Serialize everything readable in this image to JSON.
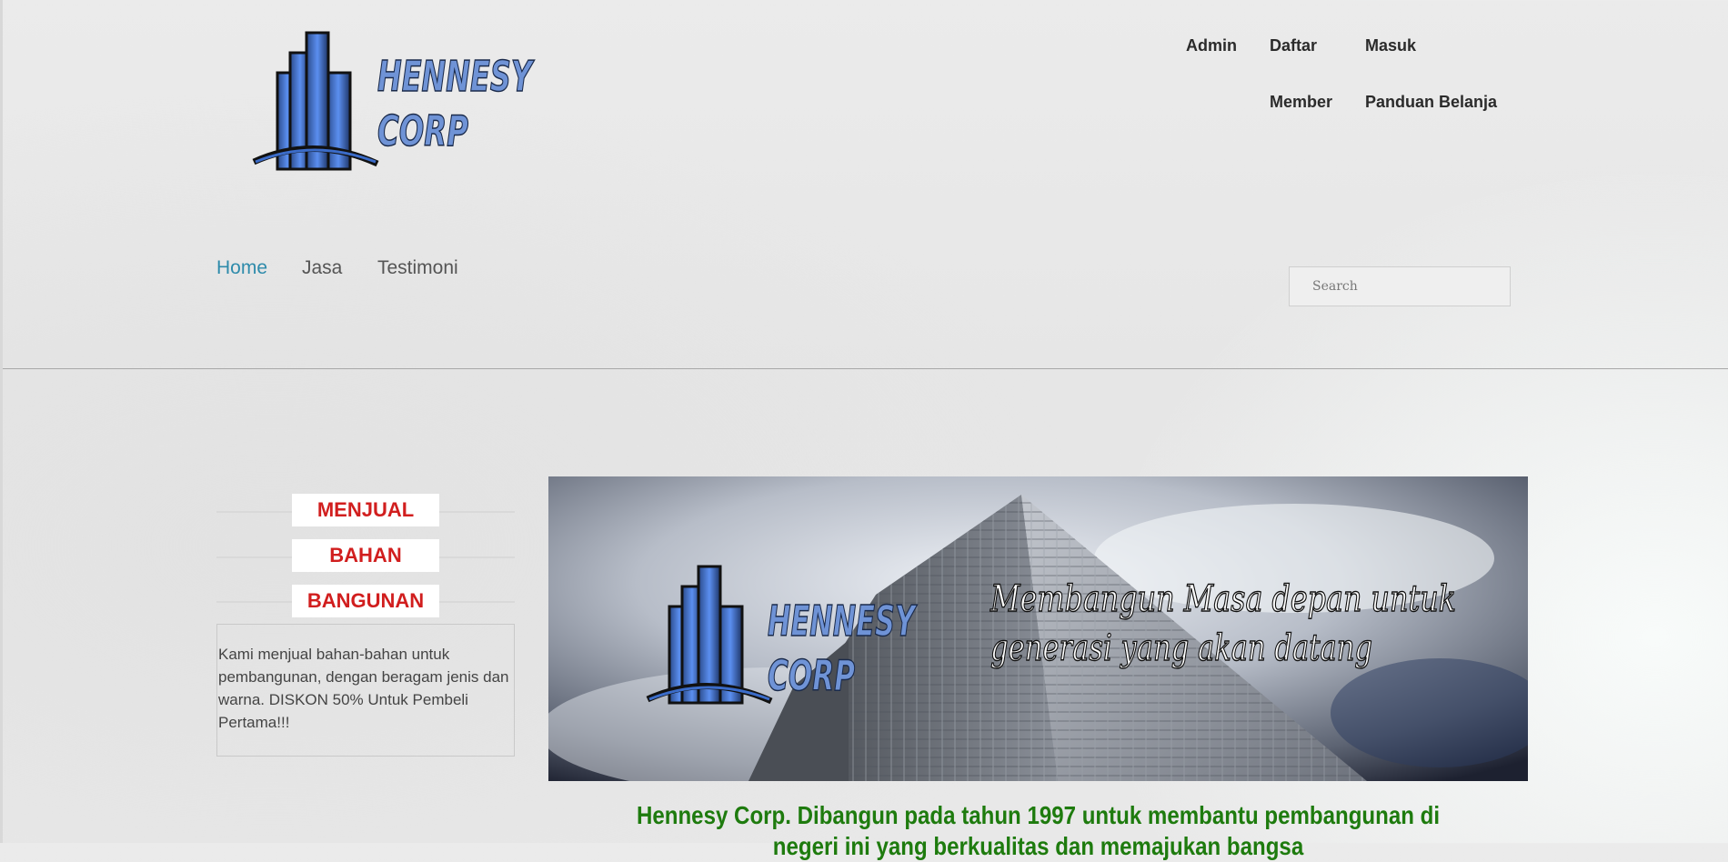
{
  "brand": {
    "logo_line1": "HENNESY",
    "logo_line2": "CORP"
  },
  "top_links": {
    "admin": "Admin",
    "daftar": "Daftar",
    "masuk": "Masuk",
    "member": "Member",
    "panduan": "Panduan Belanja"
  },
  "nav": {
    "items": [
      {
        "label": "Home",
        "active": true
      },
      {
        "label": "Jasa",
        "active": false
      },
      {
        "label": "Testimoni",
        "active": false
      }
    ]
  },
  "search": {
    "placeholder": "Search"
  },
  "sidebar": {
    "tags": [
      "MENJUAL",
      "BAHAN",
      "BANGUNAN"
    ],
    "description": "Kami menjual bahan-bahan untuk pembangunan, dengan beragam jenis dan warna. DISKON 50% Untuk Pembeli Pertama!!!"
  },
  "banner": {
    "logo_line1": "HENNESY",
    "logo_line2": "CORP",
    "tagline_line1": "Membangun Masa depan untuk",
    "tagline_line2": "generasi yang akan datang"
  },
  "headline": "Hennesy Corp. Dibangun pada tahun 1997 untuk membantu pembangunan di negeri ini yang berkualitas dan memajukan bangsa",
  "colors": {
    "accent_nav": "#2e8bab",
    "tag_red": "#d11e1e",
    "headline_green": "#1e7b0e",
    "logo_blue": "#5b86d6"
  }
}
